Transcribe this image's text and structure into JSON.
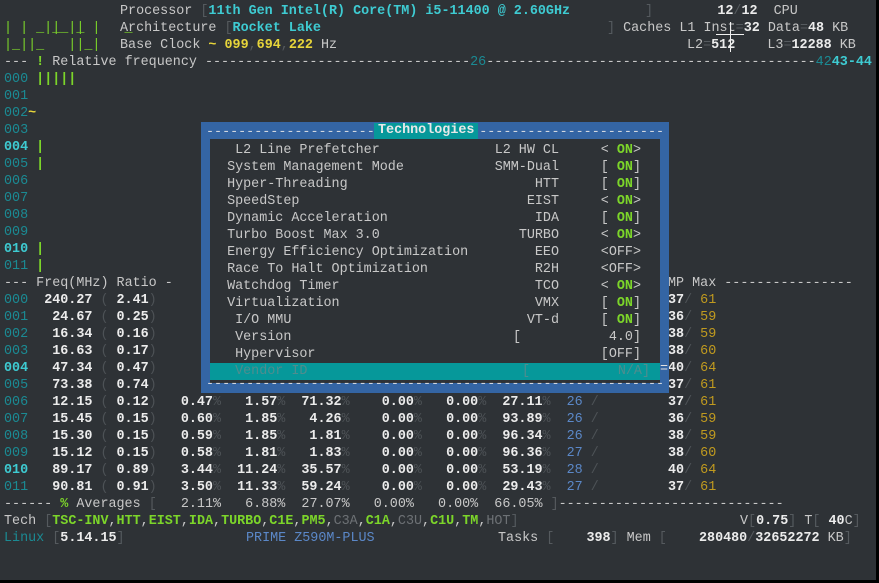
{
  "header": {
    "logo": [
      "  _  _     _  ",
      "| | _||_|| |",
      "|_||_   ||_|"
    ],
    "processor_label": "Processor",
    "processor": "11th Gen Intel(R) Core(TM) i5-11400 @ 2.60GHz",
    "cpu_count": "12",
    "cpu_total": "12",
    "cpu_label": "CPU",
    "architecture_label": "Architecture",
    "architecture": "Rocket Lake",
    "caches_label": "Caches",
    "l1_label": "L1",
    "l1_inst_label": "Inst",
    "l1_inst": "32",
    "l1_data_label": "Data",
    "l1_data": "48",
    "kb": "KB",
    "base_clock_label": "Base Clock",
    "base_clock_tilde": "~",
    "base_clock": [
      "099",
      "694",
      "222"
    ],
    "hz": "Hz",
    "l2_label": "L2",
    "l2": "512",
    "l3_label": "L3",
    "l3": "12288"
  },
  "relative_frequency": {
    "title": "Relative frequency",
    "marker_mid": "26",
    "marker_right_dim": "42",
    "marker_right": "43-44",
    "cores": [
      {
        "id": "000",
        "bar": "|||||",
        "bold": false
      },
      {
        "id": "001",
        "bar": "",
        "bold": false
      },
      {
        "id": "002",
        "bar": "~",
        "bold": false
      },
      {
        "id": "003",
        "bar": "",
        "bold": false
      },
      {
        "id": "004",
        "bar": "|",
        "bold": true
      },
      {
        "id": "005",
        "bar": "|",
        "bold": false
      },
      {
        "id": "006",
        "bar": "",
        "bold": false
      },
      {
        "id": "007",
        "bar": "",
        "bold": false
      },
      {
        "id": "008",
        "bar": "",
        "bold": false
      },
      {
        "id": "009",
        "bar": "",
        "bold": false
      },
      {
        "id": "010",
        "bar": "|",
        "bold": true
      },
      {
        "id": "011",
        "bar": "|",
        "bold": false
      }
    ]
  },
  "freq_table": {
    "headers": {
      "freq": "Freq(MHz)",
      "ratio": "Ratio",
      "temp": "MP",
      "max": "Max"
    },
    "rows": [
      {
        "id": "000",
        "freq": "240.27",
        "ratio": "2.41",
        "turbo": "",
        "c0": "",
        "c1": "",
        "c3": "",
        "c6": "",
        "c7": "",
        "min": "",
        "temp": "37",
        "max": "61",
        "bold": false
      },
      {
        "id": "001",
        "freq": "24.67",
        "ratio": "0.25",
        "turbo": "",
        "c0": "",
        "c1": "",
        "c3": "",
        "c6": "",
        "c7": "",
        "min": "",
        "temp": "36",
        "max": "59",
        "bold": false
      },
      {
        "id": "002",
        "freq": "16.34",
        "ratio": "0.16",
        "turbo": "",
        "c0": "",
        "c1": "",
        "c3": "",
        "c6": "",
        "c7": "",
        "min": "",
        "temp": "38",
        "max": "59",
        "bold": false
      },
      {
        "id": "003",
        "freq": "16.63",
        "ratio": "0.17",
        "turbo": "",
        "c0": "",
        "c1": "",
        "c3": "",
        "c6": "",
        "c7": "",
        "min": "",
        "temp": "38",
        "max": "60",
        "bold": false
      },
      {
        "id": "004",
        "freq": "47.34",
        "ratio": "0.47",
        "turbo": "",
        "c0": "",
        "c1": "",
        "c3": "",
        "c6": "",
        "c7": "",
        "min": "",
        "temp": "40",
        "max": "64",
        "bold": true
      },
      {
        "id": "005",
        "freq": "73.38",
        "ratio": "0.74",
        "turbo": "",
        "c0": "",
        "c1": "",
        "c3": "",
        "c6": "",
        "c7": "",
        "min": "",
        "temp": "37",
        "max": "61",
        "bold": false
      },
      {
        "id": "006",
        "freq": "12.15",
        "ratio": "0.12",
        "turbo": "0.47",
        "c0": "1.57",
        "c1": "71.32",
        "c3": "0.00",
        "c6": "0.00",
        "c7": "27.11",
        "min": "26",
        "temp": "37",
        "max": "61",
        "bold": false
      },
      {
        "id": "007",
        "freq": "15.45",
        "ratio": "0.15",
        "turbo": "0.60",
        "c0": "1.85",
        "c1": "4.26",
        "c3": "0.00",
        "c6": "0.00",
        "c7": "93.89",
        "min": "26",
        "temp": "36",
        "max": "59",
        "bold": false
      },
      {
        "id": "008",
        "freq": "15.30",
        "ratio": "0.15",
        "turbo": "0.59",
        "c0": "1.85",
        "c1": "1.81",
        "c3": "0.00",
        "c6": "0.00",
        "c7": "96.34",
        "min": "26",
        "temp": "38",
        "max": "59",
        "bold": false
      },
      {
        "id": "009",
        "freq": "15.12",
        "ratio": "0.15",
        "turbo": "0.58",
        "c0": "1.81",
        "c1": "1.83",
        "c3": "0.00",
        "c6": "0.00",
        "c7": "96.36",
        "min": "27",
        "temp": "38",
        "max": "60",
        "bold": false
      },
      {
        "id": "010",
        "freq": "89.17",
        "ratio": "0.89",
        "turbo": "3.44",
        "c0": "11.24",
        "c1": "35.57",
        "c3": "0.00",
        "c6": "0.00",
        "c7": "53.19",
        "min": "28",
        "temp": "40",
        "max": "64",
        "bold": true
      },
      {
        "id": "011",
        "freq": "90.81",
        "ratio": "0.91",
        "turbo": "3.50",
        "c0": "11.33",
        "c1": "59.24",
        "c3": "0.00",
        "c6": "0.00",
        "c7": "29.43",
        "min": "27",
        "temp": "37",
        "max": "61",
        "bold": false
      }
    ],
    "averages": {
      "label": "Averages",
      "values": [
        "2.11%",
        "6.88%",
        "27.07%",
        "0.00%",
        "0.00%",
        "66.05%"
      ]
    }
  },
  "footer": {
    "tech_label": "Tech",
    "tech_flags": [
      {
        "name": "TSC-INV",
        "on": true
      },
      {
        "name": "HTT",
        "on": true
      },
      {
        "name": "EIST",
        "on": true
      },
      {
        "name": "IDA",
        "on": true
      },
      {
        "name": "TURBO",
        "on": true
      },
      {
        "name": "C1E",
        "on": true
      },
      {
        "name": "PM5",
        "on": true
      },
      {
        "name": "C3A",
        "on": false
      },
      {
        "name": "C1A",
        "on": true
      },
      {
        "name": "C3U",
        "on": false
      },
      {
        "name": "C1U",
        "on": true
      },
      {
        "name": "TM",
        "on": true
      },
      {
        "name": "HOT",
        "on": false
      }
    ],
    "voltage_label": "V",
    "voltage": "0.75",
    "temp_label": "T",
    "temp": "40",
    "temp_unit": "C",
    "os": "Linux",
    "kernel": "5.14.15",
    "board": "PRIME Z590M-PLUS",
    "tasks_label": "Tasks",
    "tasks": "398",
    "mem_label": "Mem",
    "mem_used": "280480",
    "mem_total": "32652272",
    "mem_unit": "KB"
  },
  "dialog": {
    "title": "Technologies",
    "items": [
      {
        "label": " L2 Line Prefetcher",
        "code": "L2 HW CL",
        "open": "< ",
        "value": "ON",
        "close": ">",
        "on": true
      },
      {
        "label": "System Management Mode",
        "code": "SMM-Dual",
        "open": "[ ",
        "value": "ON",
        "close": "]",
        "on": true
      },
      {
        "label": "Hyper-Threading",
        "code": "HTT",
        "open": "[ ",
        "value": "ON",
        "close": "]",
        "on": true
      },
      {
        "label": "SpeedStep",
        "code": "EIST",
        "open": "< ",
        "value": "ON",
        "close": ">",
        "on": true
      },
      {
        "label": "Dynamic Acceleration",
        "code": "IDA",
        "open": "[ ",
        "value": "ON",
        "close": "]",
        "on": true
      },
      {
        "label": "Turbo Boost Max 3.0",
        "code": "TURBO",
        "open": "< ",
        "value": "ON",
        "close": ">",
        "on": true
      },
      {
        "label": "Energy Efficiency Optimization",
        "code": "EEO",
        "open": "<",
        "value": "OFF",
        "close": ">",
        "on": false
      },
      {
        "label": "Race To Halt Optimization",
        "code": "R2H",
        "open": "<",
        "value": "OFF",
        "close": ">",
        "on": false
      },
      {
        "label": "Watchdog Timer",
        "code": "TCO",
        "open": "< ",
        "value": "ON",
        "close": ">",
        "on": true
      },
      {
        "label": "Virtualization",
        "code": "VMX",
        "open": "[ ",
        "value": "ON",
        "close": "]",
        "on": true
      },
      {
        "label": " I/O MMU",
        "code": "VT-d",
        "open": "[ ",
        "value": "ON",
        "close": "]",
        "on": true
      },
      {
        "label": " Version",
        "code": "[",
        "open": "  ",
        "value": "4.0",
        "close": "]",
        "on": false
      },
      {
        "label": " Hypervisor",
        "code": "",
        "open": "[",
        "value": "OFF",
        "close": "]",
        "on": false
      },
      {
        "label": " Vendor ID",
        "code": "[",
        "open": "  ",
        "value": "N/A",
        "close": "]",
        "on": false,
        "selected": true
      }
    ]
  }
}
